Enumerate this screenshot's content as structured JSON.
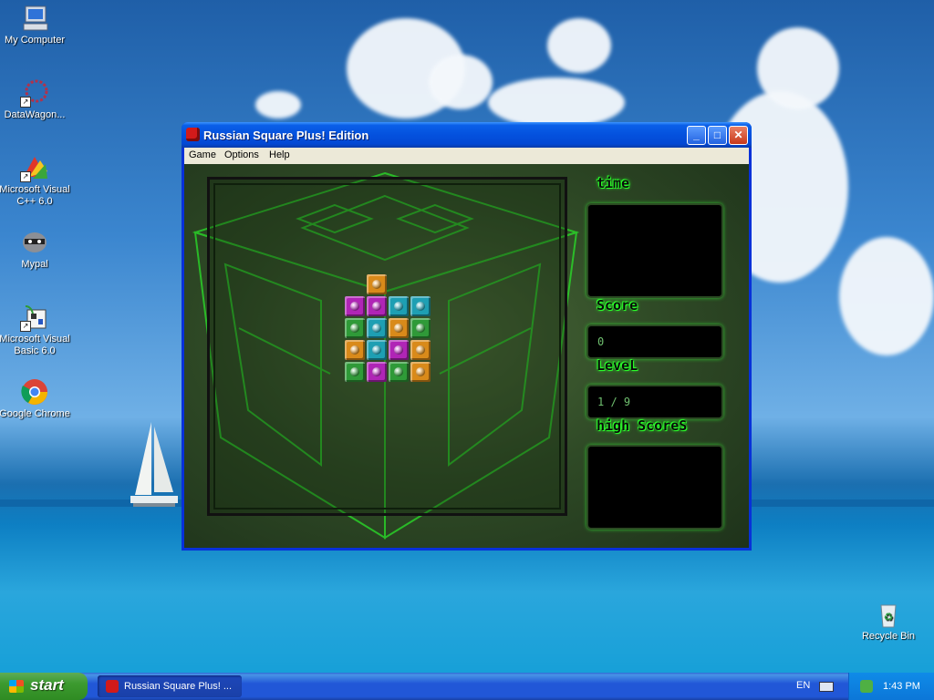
{
  "desktop": {
    "icons": [
      {
        "label": "My Computer"
      },
      {
        "label": "DataWagon..."
      },
      {
        "label": "Microsoft Visual C++ 6.0"
      },
      {
        "label": "Mypal"
      },
      {
        "label": "Microsoft Visual Basic 6.0"
      },
      {
        "label": "Google Chrome"
      },
      {
        "label": "Recycle Bin"
      }
    ]
  },
  "window": {
    "title": "Russian Square Plus! Edition",
    "buttons": {
      "minimize": "_",
      "maximize": "□",
      "close": "✕"
    },
    "menu": [
      "Game",
      "Options",
      "Help"
    ]
  },
  "game": {
    "panels": {
      "time": {
        "label": "time",
        "value": ""
      },
      "score": {
        "label": "Score",
        "value": "0"
      },
      "level": {
        "label": "LeveL",
        "value": "1 / 9"
      },
      "high_scores": {
        "label": "high ScoreS",
        "value": ""
      }
    },
    "block_colors": {
      "orange": "#d98a1a",
      "purple": "#b025b6",
      "teal": "#1e9fb3",
      "green": "#2f9a38"
    },
    "grid": [
      [
        "",
        "orange",
        "",
        ""
      ],
      [
        "purple",
        "purple",
        "teal",
        "teal"
      ],
      [
        "green",
        "teal",
        "orange",
        "green"
      ],
      [
        "orange",
        "teal",
        "purple",
        "orange"
      ],
      [
        "green",
        "purple",
        "green",
        "orange"
      ]
    ]
  },
  "taskbar": {
    "start_label": "start",
    "task_button": "Russian Square Plus! ...",
    "language": "EN",
    "clock": "1:43 PM"
  }
}
